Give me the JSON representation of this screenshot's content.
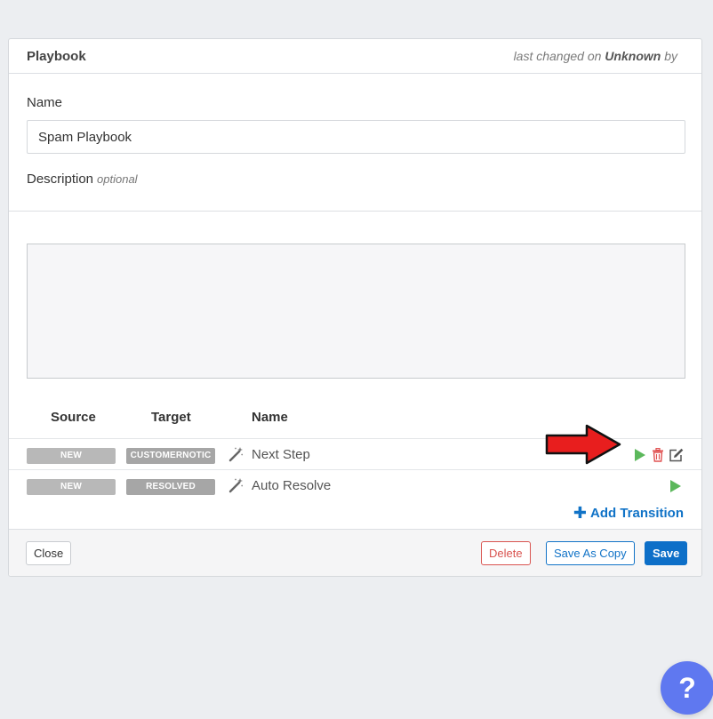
{
  "header": {
    "title": "Playbook",
    "last_changed_prefix": "last changed on",
    "last_changed_value": "Unknown",
    "last_changed_suffix": "by"
  },
  "form": {
    "name_label": "Name",
    "name_value": "Spam Playbook",
    "description_label": "Description",
    "description_optional": "optional"
  },
  "table": {
    "headers": [
      "Source",
      "Target",
      "Name"
    ],
    "rows": [
      {
        "source": "NEW",
        "target": "CUSTOMERNOTIC",
        "name": "Next Step"
      },
      {
        "source": "NEW",
        "target": "RESOLVED",
        "name": "Auto Resolve"
      }
    ]
  },
  "add_transition_label": "Add Transition",
  "footer": {
    "close_label": "Close",
    "delete_label": "Delete",
    "save_copy_label": "Save As Copy",
    "save_label": "Save"
  },
  "help_label": "?",
  "colors": {
    "accent": "#0d6fc8",
    "link": "#1173c7",
    "danger": "#d9534f",
    "success": "#5cb85c",
    "help": "#5f78f0",
    "arrow": "#e81e1e"
  },
  "icons": [
    "magic-wand-icon",
    "play-icon",
    "trash-icon",
    "edit-icon",
    "plus-icon",
    "question-icon"
  ]
}
